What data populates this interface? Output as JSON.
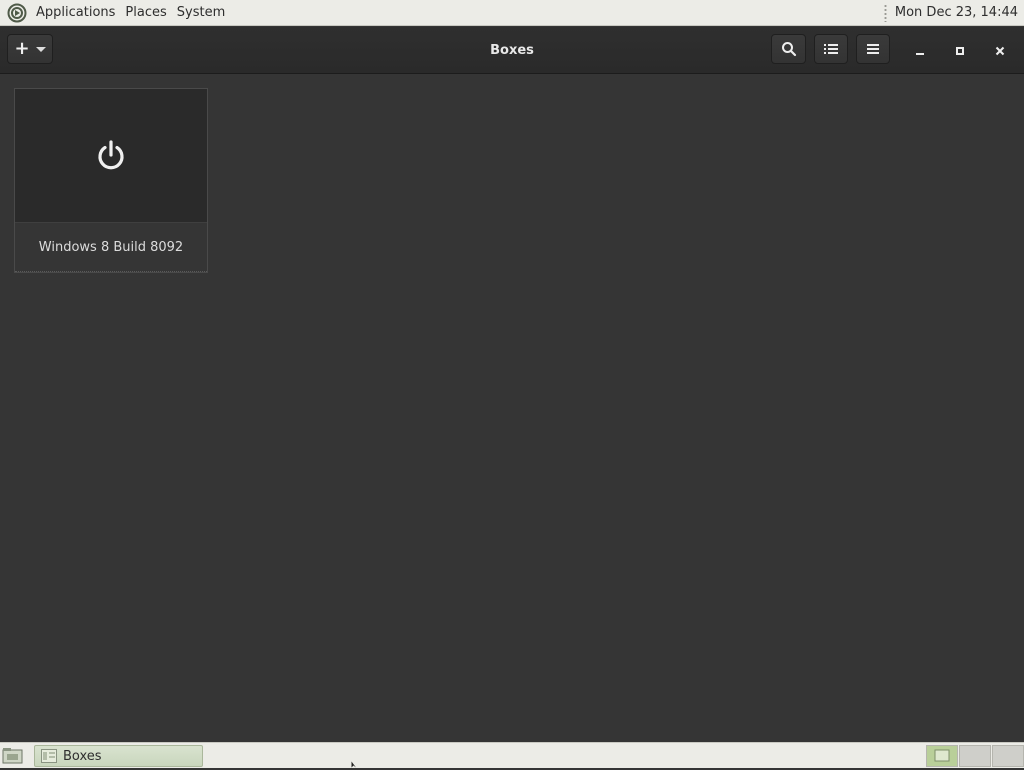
{
  "top_panel": {
    "menus": [
      "Applications",
      "Places",
      "System"
    ],
    "clock": "Mon Dec 23, 14:44"
  },
  "headerbar": {
    "title": "Boxes",
    "icons": {
      "new": "plus-icon",
      "new_menu": "chevron-down-icon",
      "search": "search-icon",
      "view": "list-view-icon",
      "menu": "hamburger-menu-icon",
      "minimize": "minimize-icon",
      "maximize": "maximize-icon",
      "close": "close-icon"
    }
  },
  "machines": [
    {
      "name": "Windows 8 Build 8092",
      "state_icon": "power-icon"
    }
  ],
  "bottom_panel": {
    "tasks": [
      {
        "label": "Boxes"
      }
    ],
    "workspaces": 3
  },
  "colors": {
    "panel_bg": "#ecece7",
    "window_bg": "#353535",
    "headerbar_bg": "#2c2c2c",
    "accent_green": "#b9cf99"
  }
}
